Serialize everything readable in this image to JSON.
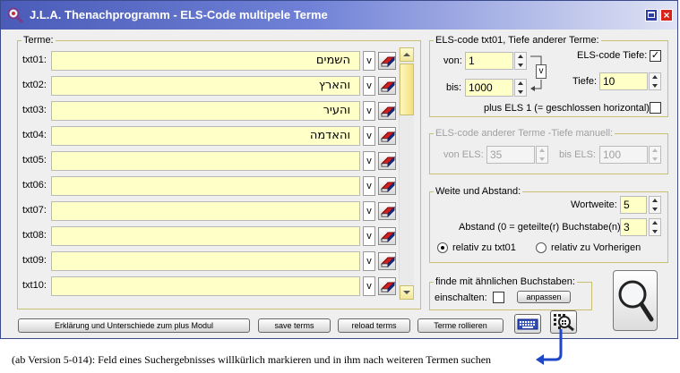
{
  "window": {
    "title": "J.L.A. Thenachprogramm - ELS-Code multipele Terme"
  },
  "terms": {
    "legend": "Terme:",
    "v_label": "v",
    "rows": [
      {
        "label": "txt01:",
        "value": "השמים"
      },
      {
        "label": "txt02:",
        "value": "והארץ"
      },
      {
        "label": "txt03:",
        "value": "והעיר"
      },
      {
        "label": "txt04:",
        "value": "והאדמה"
      },
      {
        "label": "txt05:",
        "value": ""
      },
      {
        "label": "txt06:",
        "value": ""
      },
      {
        "label": "txt07:",
        "value": ""
      },
      {
        "label": "txt08:",
        "value": ""
      },
      {
        "label": "txt09:",
        "value": ""
      },
      {
        "label": "txt10:",
        "value": ""
      }
    ]
  },
  "els_code": {
    "legend": "ELS-code txt01, Tiefe anderer Terme:",
    "von_label": "von:",
    "von_value": "1",
    "bis_label": "bis:",
    "bis_value": "1000",
    "swap_label": "v",
    "tiefe_check_label": "ELS-code Tiefe:",
    "tiefe_check_mark": "✓",
    "tiefe_label": "Tiefe:",
    "tiefe_value": "10",
    "plus_els_label": "plus ELS 1 (= geschlossen horizontal):"
  },
  "els_manual": {
    "legend": "ELS-code anderer Terme -Tiefe manuell:",
    "von_label": "von ELS:",
    "von_value": "35",
    "bis_label": "bis ELS:",
    "bis_value": "100"
  },
  "weite": {
    "legend": "Weite und Abstand:",
    "wortweite_label": "Wortweite:",
    "wortweite_value": "5",
    "abstand_label": "Abstand (0 = geteilte(r) Buchstabe(n)):",
    "abstand_value": "3",
    "radio1_label": "relativ zu txt01",
    "radio2_label": "relativ zu Vorherigen"
  },
  "aehnlich": {
    "legend": "finde mit ähnlichen Buchstaben:",
    "einschalten_label": "einschalten:",
    "anpassen_label": "anpassen"
  },
  "buttons": {
    "erklaerung": "Erklärung und Unterschiede zum plus Modul",
    "save": "save terms",
    "reload": "reload terms",
    "rollieren": "Terme rollieren"
  },
  "footer_note": "(ab Version 5-014): Feld eines Suchergebnisses willkürlich markieren und in ihm nach weiteren Termen suchen",
  "colors": {
    "title_start": "#4a5cb8",
    "input_bg": "#ffffc8",
    "arrow": "#2046c8"
  }
}
